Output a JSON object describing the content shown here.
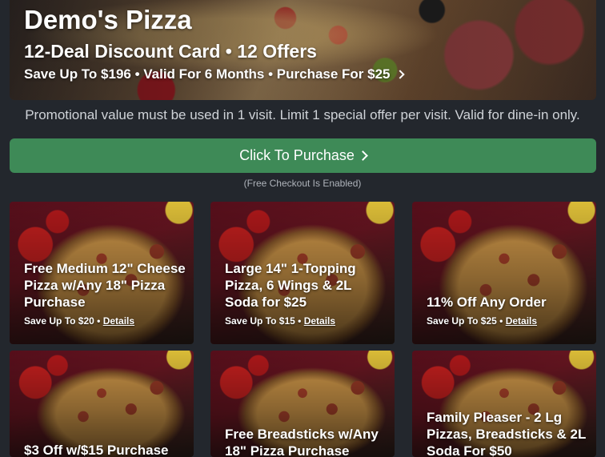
{
  "hero": {
    "title": "Demo's Pizza",
    "subtitle": "12-Deal Discount Card • 12 Offers",
    "info": "Save Up To $196 • Valid For 6 Months • Purchase For $25"
  },
  "promo_text": "Promotional value must be used in 1 visit. Limit 1 special offer per visit. Valid for dine-in only.",
  "purchase_button": "Click To Purchase",
  "free_checkout_note": "(Free Checkout Is Enabled)",
  "colors": {
    "background": "#23272d",
    "accent_green": "#3e8a57"
  },
  "offers": [
    {
      "title": "Free Medium 12\" Cheese Pizza w/Any 18\" Pizza Purchase",
      "save": "Save Up To $20",
      "details": "Details"
    },
    {
      "title": "Large 14\" 1-Topping Pizza, 6 Wings & 2L Soda for $25",
      "save": "Save Up To $15",
      "details": "Details"
    },
    {
      "title": "11% Off Any Order",
      "save": "Save Up To $25",
      "details": "Details"
    },
    {
      "title": "$3 Off w/$15 Purchase"
    },
    {
      "title": "Free Breadsticks w/Any 18\" Pizza Purchase"
    },
    {
      "title": "Family Pleaser - 2 Lg Pizzas, Breadsticks & 2L Soda For $50"
    }
  ]
}
